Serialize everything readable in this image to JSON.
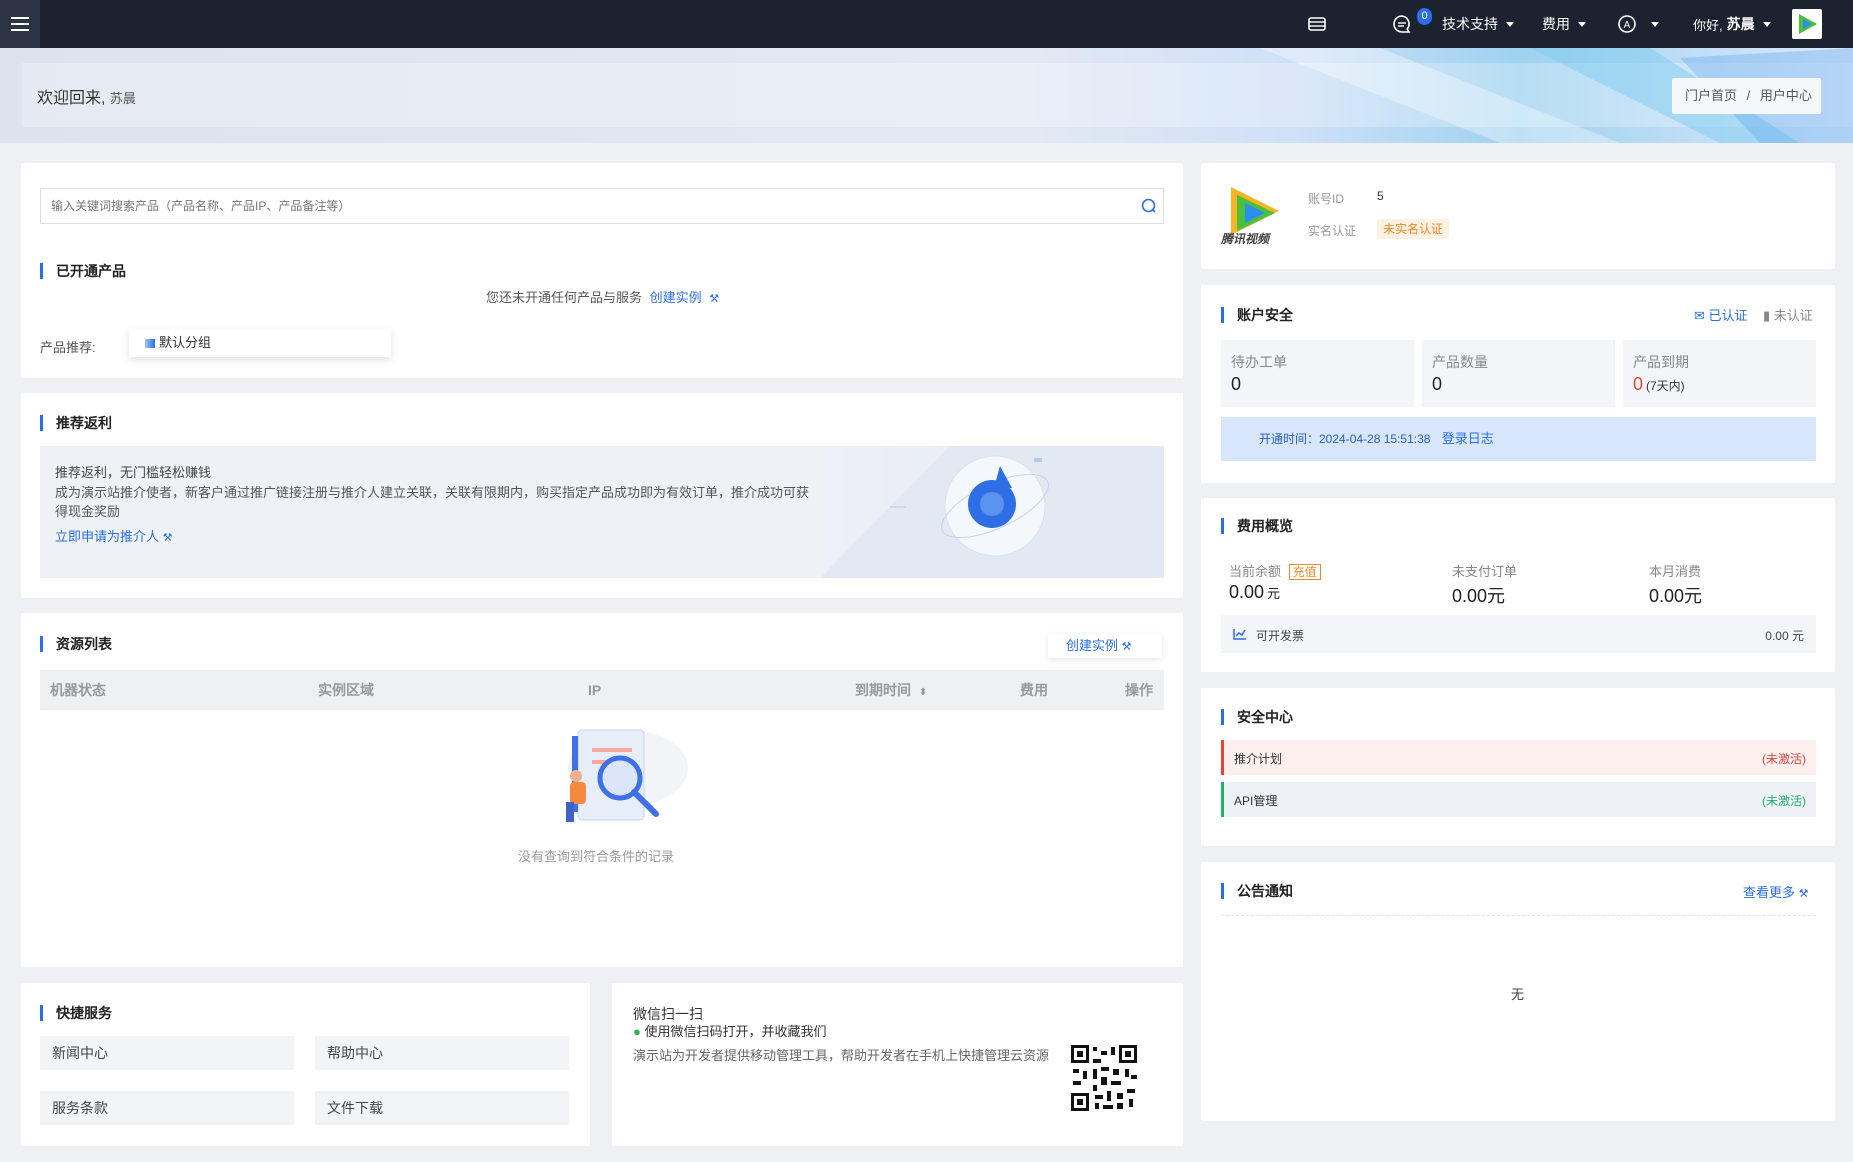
{
  "topbar": {
    "support": "技术支持",
    "fees": "费用",
    "msg_count": "0",
    "greeting": "你好,",
    "username": "苏晨"
  },
  "banner": {
    "welcome": "欢迎回来,",
    "username": "苏晨",
    "breadcrumb": {
      "home": "门户首页",
      "sep": "/",
      "current": "用户中心"
    }
  },
  "search": {
    "placeholder": "输入关键词搜索产品（产品名称、产品IP、产品备注等）"
  },
  "opened": {
    "title": "已开通产品",
    "empty_text": "您还未开通任何产品与服务",
    "create_link": "创建实例",
    "recommend_label": "产品推荐:",
    "group": "默认分组"
  },
  "referral": {
    "title": "推荐返利",
    "headline": "推荐返利，无门槛轻松赚钱",
    "desc": "成为演示站推介使者，新客户通过推广链接注册与推介人建立关联，关联有限期内，购买指定产品成功即为有效订单，推介成功可获得现金奖励",
    "apply_link": "立即申请为推介人"
  },
  "resources": {
    "title": "资源列表",
    "create_button": "创建实例",
    "columns": [
      "机器状态",
      "实例区域",
      "IP",
      "到期时间",
      "费用",
      "操作"
    ],
    "empty_text": "没有查询到符合条件的记录"
  },
  "quick": {
    "title": "快捷服务",
    "items": [
      "新闻中心",
      "帮助中心",
      "服务条款",
      "文件下载"
    ]
  },
  "wechat": {
    "title": "微信扫一扫",
    "subtitle": "使用微信扫码打开，并收藏我们",
    "desc": "演示站为开发者提供移动管理工具，帮助开发者在手机上快捷管理云资源"
  },
  "account": {
    "logo_text": "腾讯视频",
    "id_label": "账号ID",
    "id_value": "5",
    "realname_label": "实名认证",
    "realname_status": "未实名认证"
  },
  "security": {
    "title": "账户安全",
    "verified": "已认证",
    "unverified": "未认证",
    "stats": [
      {
        "label": "待办工单",
        "value": "0"
      },
      {
        "label": "产品数量",
        "value": "0"
      },
      {
        "label": "产品到期",
        "value": "0",
        "note": "(7天内)"
      }
    ],
    "open_time": "开通时间：2024-04-28 15:51:38",
    "login_log": "登录日志"
  },
  "fees": {
    "title": "费用概览",
    "balance_label": "当前余额",
    "recharge": "充值",
    "balance_value": "0.00",
    "unit": "元",
    "unpaid_label": "未支付订单",
    "unpaid_value": "0.00元",
    "month_label": "本月消费",
    "month_value": "0.00元",
    "invoice_label": "可开发票",
    "invoice_value": "0.00 元"
  },
  "safety": {
    "title": "安全中心",
    "items": [
      {
        "label": "推介计划",
        "status": "(未激活)",
        "color": "#e0463c"
      },
      {
        "label": "API管理",
        "status": "(未激活)",
        "color": "#22b06a"
      }
    ]
  },
  "notice": {
    "title": "公告通知",
    "more": "查看更多",
    "empty": "无"
  },
  "colors": {
    "accent": "#2a6ee8",
    "topbar": "#1c2230",
    "warn": "#f08a24"
  }
}
